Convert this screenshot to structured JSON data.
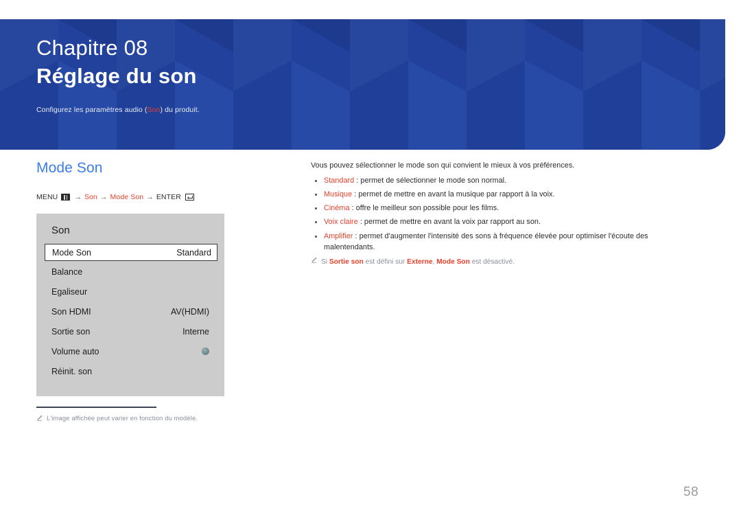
{
  "banner": {
    "chapter": "Chapitre 08",
    "title": "Réglage du son",
    "subtitle_before": "Configurez les paramètres audio (",
    "subtitle_highlight": "Son",
    "subtitle_after": ") du produit.",
    "background_color": "#20409a"
  },
  "section": {
    "title": "Mode Son",
    "title_color": "#3b7ded"
  },
  "breadcrumb": {
    "menu_label": "MENU",
    "menu_icon": "menu-icon",
    "arrow": "→",
    "step1": "Son",
    "step2": "Mode Son",
    "enter_label": "ENTER",
    "enter_icon": "enter-icon",
    "accent_color": "#e8402a"
  },
  "osd": {
    "title": "Son",
    "rows": [
      {
        "label": "Mode Son",
        "value": "Standard",
        "selected": true,
        "control": "text"
      },
      {
        "label": "Balance",
        "value": "",
        "selected": false,
        "control": "none"
      },
      {
        "label": "Egaliseur",
        "value": "",
        "selected": false,
        "control": "none"
      },
      {
        "label": "Son HDMI",
        "value": "AV(HDMI)",
        "selected": false,
        "control": "text"
      },
      {
        "label": "Sortie son",
        "value": "Interne",
        "selected": false,
        "control": "text"
      },
      {
        "label": "Volume auto",
        "value": "",
        "selected": false,
        "control": "dot"
      },
      {
        "label": "Réinit. son",
        "value": "",
        "selected": false,
        "control": "none"
      }
    ],
    "panel_color": "#cccccc"
  },
  "footnote": {
    "icon": "pencil-icon",
    "text": "L'image affichée peut varier en fonction du modèle."
  },
  "description": {
    "intro": "Vous pouvez sélectionner le mode son qui convient le mieux à vos préférences.",
    "bullets": [
      {
        "term": "Standard",
        "rest": " : permet de sélectionner le mode son normal."
      },
      {
        "term": "Musique",
        "rest": " : permet de mettre en avant la musique par rapport à la voix."
      },
      {
        "term": "Cinéma",
        "rest": " : offre le meilleur son possible pour les films."
      },
      {
        "term": "Voix claire",
        "rest": " : permet de mettre en avant la voix par rapport au son."
      },
      {
        "term": "Amplifier",
        "rest": " : permet d'augmenter l'intensité des sons à fréquence élevée pour optimiser l'écoute des malentendants."
      }
    ],
    "note": {
      "icon": "pencil-icon",
      "p1": "Si ",
      "b1": "Sortie son",
      "p2": " est défini sur ",
      "b2": "Externe",
      "p3": ", ",
      "b3": "Mode Son",
      "p4": " est désactivé."
    }
  },
  "page_number": "58"
}
